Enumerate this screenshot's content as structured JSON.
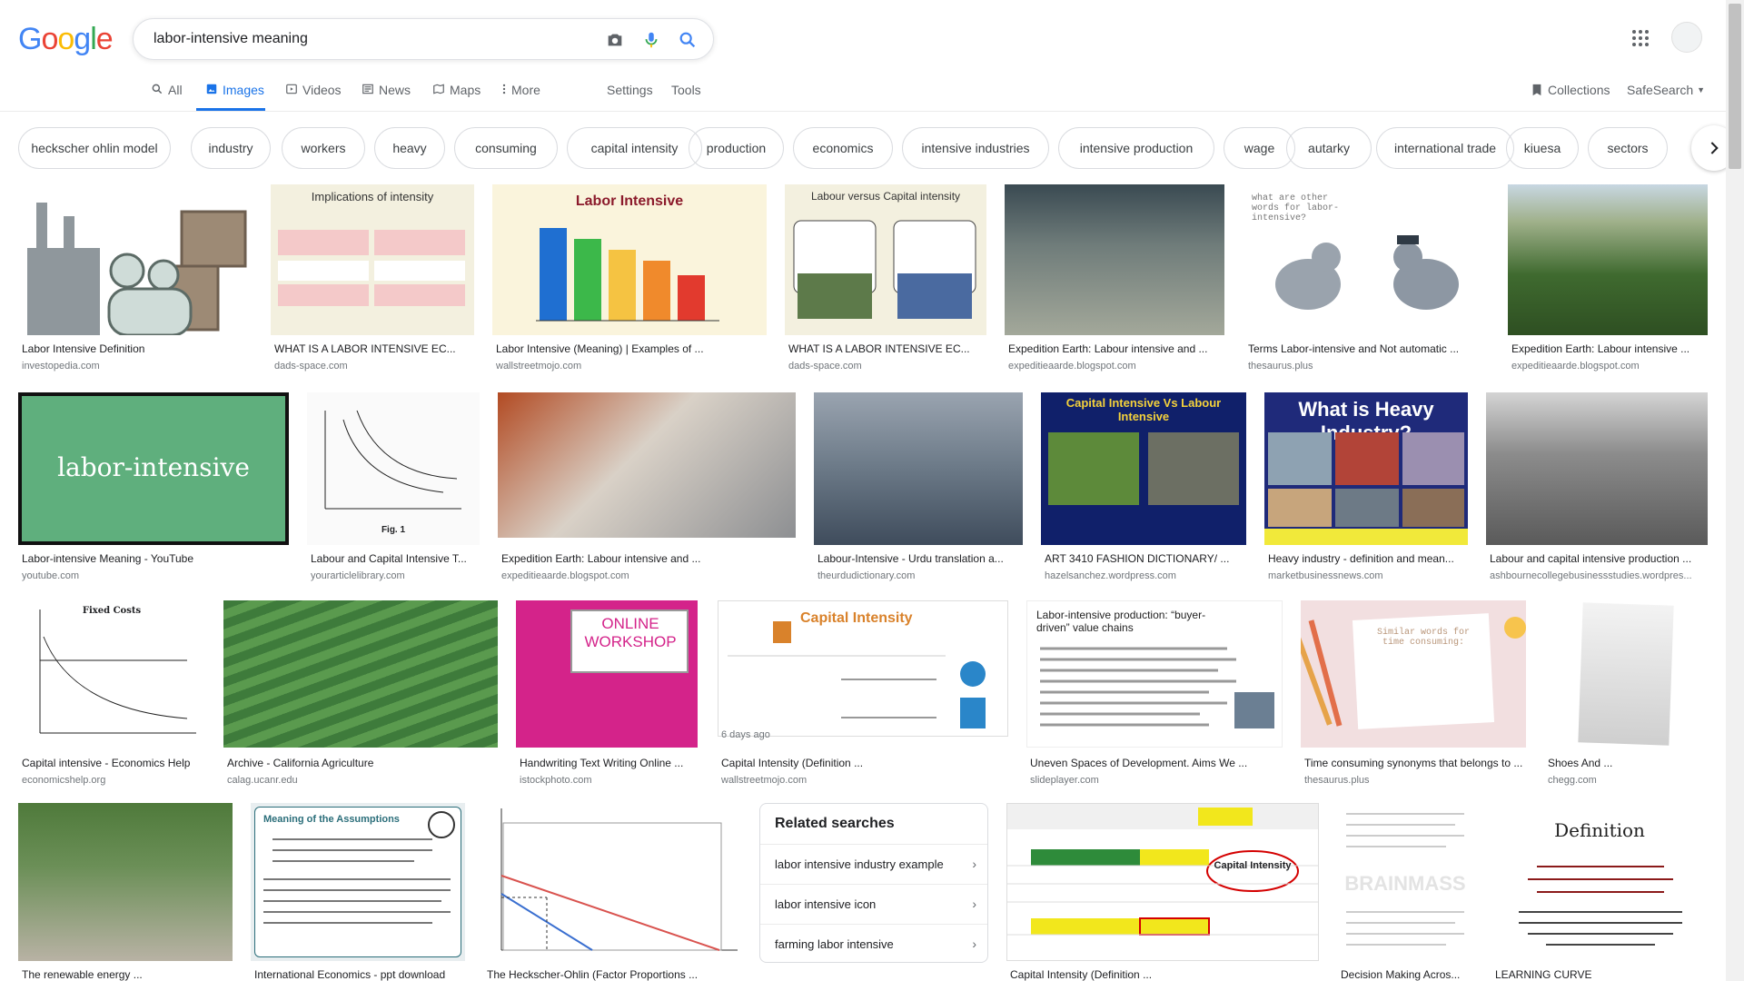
{
  "search": {
    "query": "labor-intensive meaning"
  },
  "logo": {
    "letters": [
      "G",
      "o",
      "o",
      "g",
      "l",
      "e"
    ]
  },
  "tabs": [
    {
      "label": "All",
      "icon": "search-icon"
    },
    {
      "label": "Images",
      "icon": "image-icon"
    },
    {
      "label": "Videos",
      "icon": "video-icon"
    },
    {
      "label": "News",
      "icon": "news-icon"
    },
    {
      "label": "Maps",
      "icon": "maps-icon"
    },
    {
      "label": "More",
      "icon": "more-vert-icon"
    }
  ],
  "tools": {
    "settings": "Settings",
    "tools": "Tools",
    "collections": "Collections",
    "safesearch": "SafeSearch"
  },
  "chips": [
    "heckscher ohlin model",
    "industry",
    "workers",
    "heavy",
    "consuming",
    "capital intensity",
    "production",
    "economics",
    "intensive industries",
    "intensive production",
    "wage",
    "autarky",
    "international trade",
    "kiuesa",
    "sectors"
  ],
  "results": [
    {
      "title": "Labor Intensive Definition",
      "site": "investopedia.com"
    },
    {
      "title": "WHAT IS A LABOR INTENSIVE EC...",
      "site": "dads-space.com",
      "thumb_text": "Implications of intensity"
    },
    {
      "title": "Labor Intensive (Meaning) | Examples of ...",
      "site": "wallstreetmojo.com",
      "thumb_text": "Labor Intensive"
    },
    {
      "title": "WHAT IS A LABOR INTENSIVE EC...",
      "site": "dads-space.com",
      "thumb_text": "Labour versus Capital intensity"
    },
    {
      "title": "Expedition Earth: Labour intensive and ...",
      "site": "expeditieaarde.blogspot.com"
    },
    {
      "title": "Terms Labor-intensive and Not automatic ...",
      "site": "thesaurus.plus",
      "thumb_text": "what are other words for labor-intensive?"
    },
    {
      "title": "Expedition Earth: Labour intensive ...",
      "site": "expeditieaarde.blogspot.com"
    },
    {
      "title": "Labor-intensive Meaning - YouTube",
      "site": "youtube.com",
      "thumb_text": "labor-intensive"
    },
    {
      "title": "Labour and Capital Intensive T...",
      "site": "yourarticlelibrary.com",
      "thumb_text": "Fig. 1"
    },
    {
      "title": "Expedition Earth: Labour intensive and ...",
      "site": "expeditieaarde.blogspot.com"
    },
    {
      "title": "Labour-Intensive - Urdu translation a...",
      "site": "theurdudictionary.com"
    },
    {
      "title": "ART 3410 FASHION DICTIONARY/ ...",
      "site": "hazelsanchez.wordpress.com",
      "thumb_text": "Capital Intensive Vs Labour Intensive"
    },
    {
      "title": "Heavy industry - definition and mean...",
      "site": "marketbusinessnews.com",
      "thumb_text": "What is Heavy Industry?"
    },
    {
      "title": "Labour and capital intensive production ...",
      "site": "ashbournecollegebusinessstudies.wordpres..."
    },
    {
      "title": "Capital intensive - Economics Help",
      "site": "economicshelp.org",
      "thumb_text": "Fixed Costs"
    },
    {
      "title": "Archive - California Agriculture",
      "site": "calag.ucanr.edu"
    },
    {
      "title": "Handwriting Text Writing Online ...",
      "site": "istockphoto.com",
      "thumb_text": "ONLINE WORKSHOP"
    },
    {
      "title": "Capital Intensity (Definition ...",
      "site": "wallstreetmojo.com",
      "thumb_text": "Capital Intensity",
      "badge": "6 days ago"
    },
    {
      "title": "Uneven Spaces of Development. Aims We ...",
      "site": "slideplayer.com",
      "thumb_text": "Labor-intensive production: “buyer-driven” value chains"
    },
    {
      "title": "Time consuming synonyms that belongs to ...",
      "site": "thesaurus.plus",
      "thumb_text": "Similar words for time consuming:"
    },
    {
      "title": "Shoes And ...",
      "site": "chegg.com"
    },
    {
      "title": "The renewable energy ...",
      "site": ""
    },
    {
      "title": "International Economics - ppt download",
      "site": "",
      "thumb_text": "Meaning of the Assumptions"
    },
    {
      "title": "The Heckscher-Ohlin (Factor Proportions ...",
      "site": ""
    },
    {
      "title": "Capital Intensity (Definition ...",
      "site": "",
      "thumb_text": "Capital Intensity"
    },
    {
      "title": "Decision Making Acros...",
      "site": "",
      "thumb_text": "BRAINMASS"
    },
    {
      "title": "LEARNING CURVE",
      "site": "",
      "thumb_text": "Definition"
    }
  ],
  "related": {
    "heading": "Related searches",
    "items": [
      "labor intensive industry example",
      "labor intensive icon",
      "farming labor intensive"
    ]
  }
}
